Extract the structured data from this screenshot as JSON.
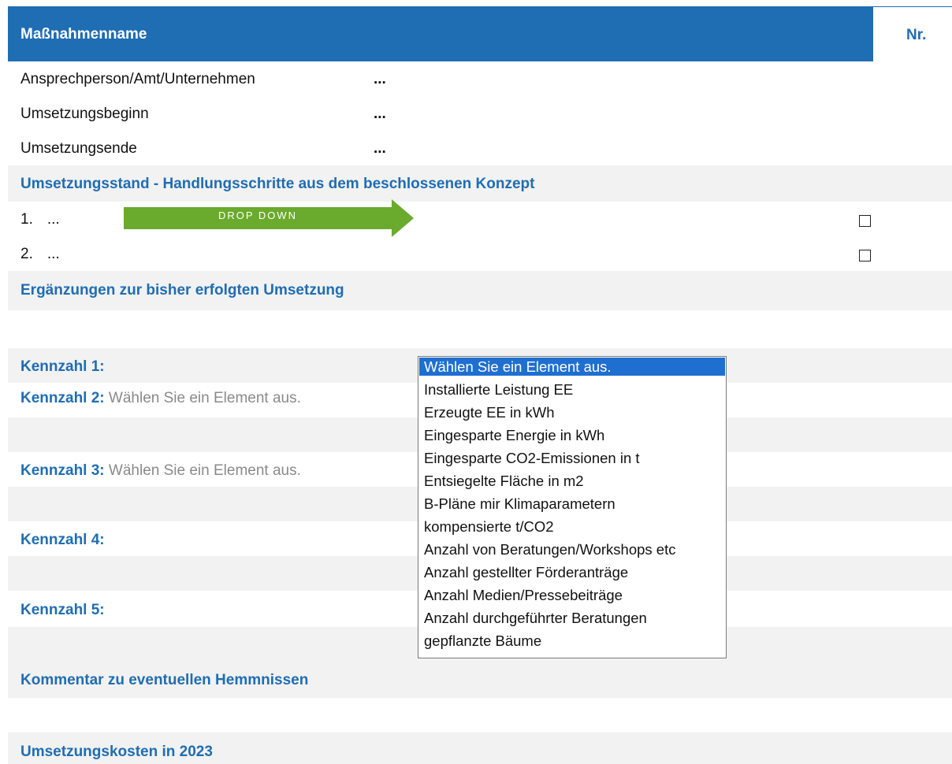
{
  "header": {
    "title": "Maßnahmenname",
    "nr_label": "Nr."
  },
  "info_rows": [
    {
      "label": "Ansprechperson/Amt/Unternehmen",
      "value": "..."
    },
    {
      "label": "Umsetzungsbeginn",
      "value": "..."
    },
    {
      "label": "Umsetzungsende",
      "value": "..."
    }
  ],
  "sections": {
    "umsetzungsstand": "Umsetzungsstand - Handlungsschritte aus dem beschlossenen Konzept",
    "ergaenzungen": "Ergänzungen zur bisher erfolgten Umsetzung",
    "kommentar": "Kommentar zu eventuellen Hemmnissen",
    "kosten": "Umsetzungskosten in 2023"
  },
  "steps": [
    {
      "number": "1.",
      "text": "...",
      "checked": false
    },
    {
      "number": "2.",
      "text": "...",
      "checked": false
    }
  ],
  "kennzahlen": [
    {
      "label": "Kennzahl 1:",
      "placeholder": ""
    },
    {
      "label": "Kennzahl 2:",
      "placeholder": "Wählen Sie ein Element aus."
    },
    {
      "label": "Kennzahl 3:",
      "placeholder": "Wählen Sie ein Element aus."
    },
    {
      "label": "Kennzahl 4:",
      "placeholder": ""
    },
    {
      "label": "Kennzahl 5:",
      "placeholder": ""
    }
  ],
  "annotation": {
    "label": "DROP DOWN",
    "color": "#6aaa2c"
  },
  "dropdown": {
    "selected_index": 0,
    "options": [
      "Wählen Sie ein Element aus.",
      "Installierte Leistung EE",
      "Erzeugte EE in kWh",
      "Eingesparte Energie in kWh",
      "Eingesparte CO2-Emissionen in t",
      "Entsiegelte Fläche in m2",
      "B-Pläne mir Klimaparametern",
      "kompensierte t/CO2",
      "Anzahl von Beratungen/Workshops etc",
      "Anzahl gestellter Förderanträge",
      "Anzahl Medien/Pressebeiträge",
      "Anzahl durchgeführter Beratungen",
      "gepflanzte Bäume"
    ]
  },
  "colors": {
    "brand": "#1f6db3",
    "highlight": "#1f6fd1",
    "shade": "#f2f2f2"
  }
}
